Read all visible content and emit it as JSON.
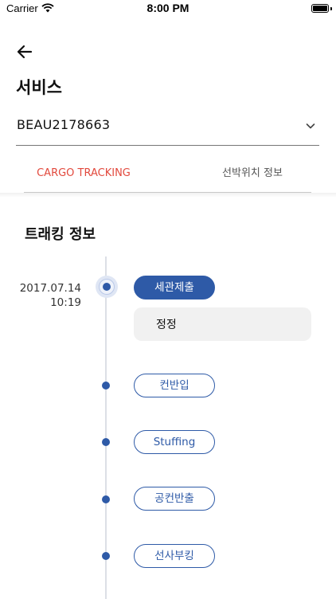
{
  "status_bar": {
    "carrier": "Carrier",
    "time": "8:00 PM",
    "battery_level": 1.0
  },
  "header": {
    "back_icon": "arrow-left-icon",
    "title": "서비스"
  },
  "container_select": {
    "value": "BEAU2178663",
    "icon": "chevron-down-icon"
  },
  "tabs": [
    {
      "label": "CARGO TRACKING",
      "active": true
    },
    {
      "label": "선박위치 정보",
      "active": false
    }
  ],
  "tracking": {
    "title": "트래킹 정보",
    "date": "2017.07.14",
    "time": "10:19",
    "steps": [
      {
        "label": "세관제출",
        "state": "current"
      },
      {
        "label": "컨반입",
        "state": "pending"
      },
      {
        "label": "Stuffing",
        "state": "pending"
      },
      {
        "label": "공컨반출",
        "state": "pending"
      },
      {
        "label": "선사부킹",
        "state": "pending"
      }
    ],
    "note": "정정"
  },
  "colors": {
    "accent": "#2e5aa7",
    "active_tab": "#e2493d",
    "note_background": "#f1f1f1"
  }
}
